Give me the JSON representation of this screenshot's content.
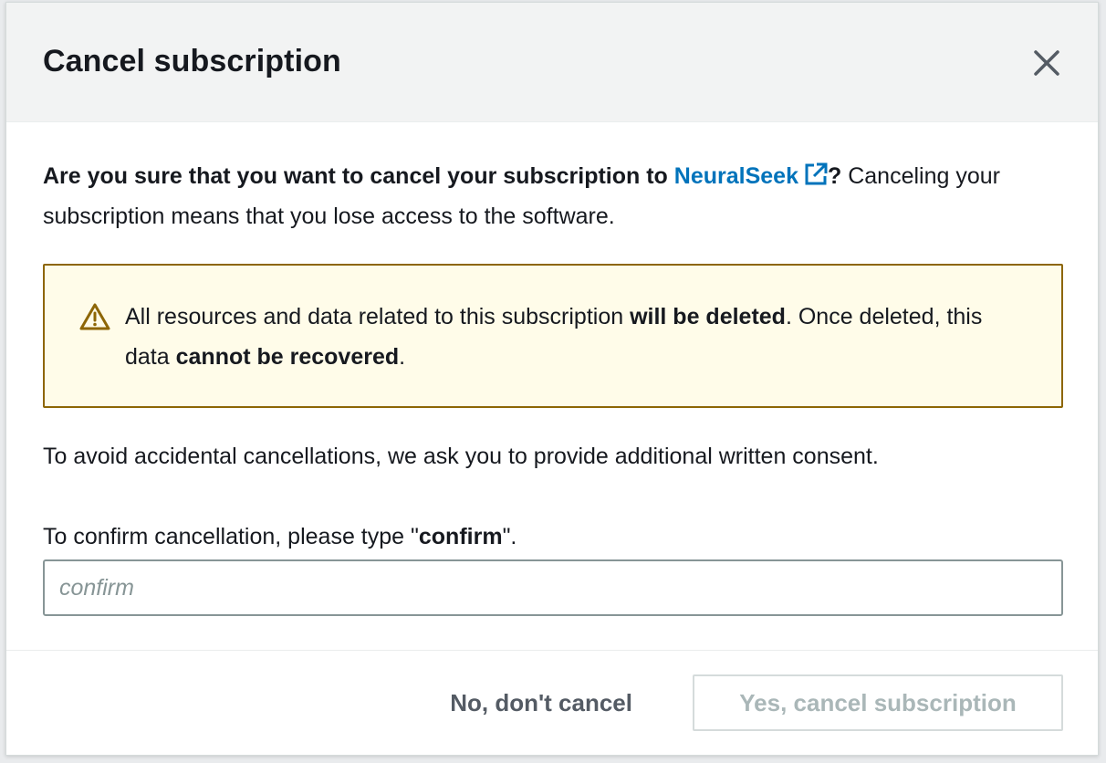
{
  "dialog": {
    "title": "Cancel subscription",
    "close_label": "Close"
  },
  "intro": {
    "question_prefix": "Are you sure that you want to cancel your subscription to ",
    "product_link": "NeuralSeek",
    "question_suffix": "?",
    "explanation": " Canceling your subscription means that you lose access to the software."
  },
  "alert": {
    "icon": "warning-icon",
    "text_1": "All resources and data related to this subscription ",
    "bold_1": "will be deleted",
    "text_2": ". Once deleted, this data ",
    "bold_2": "cannot be recovered",
    "text_3": "."
  },
  "consent_text": "To avoid accidental cancellations, we ask you to provide additional written consent.",
  "confirm": {
    "label_prefix": "To confirm cancellation, please type \"",
    "label_keyword": "confirm",
    "label_suffix": "\".",
    "placeholder": "confirm",
    "value": ""
  },
  "footer": {
    "secondary_label": "No, don't cancel",
    "primary_label": "Yes, cancel subscription"
  },
  "colors": {
    "link": "#0073bb",
    "alert_border": "#8d6605",
    "alert_background": "#fffce9",
    "disabled_text": "#aab7b8"
  }
}
